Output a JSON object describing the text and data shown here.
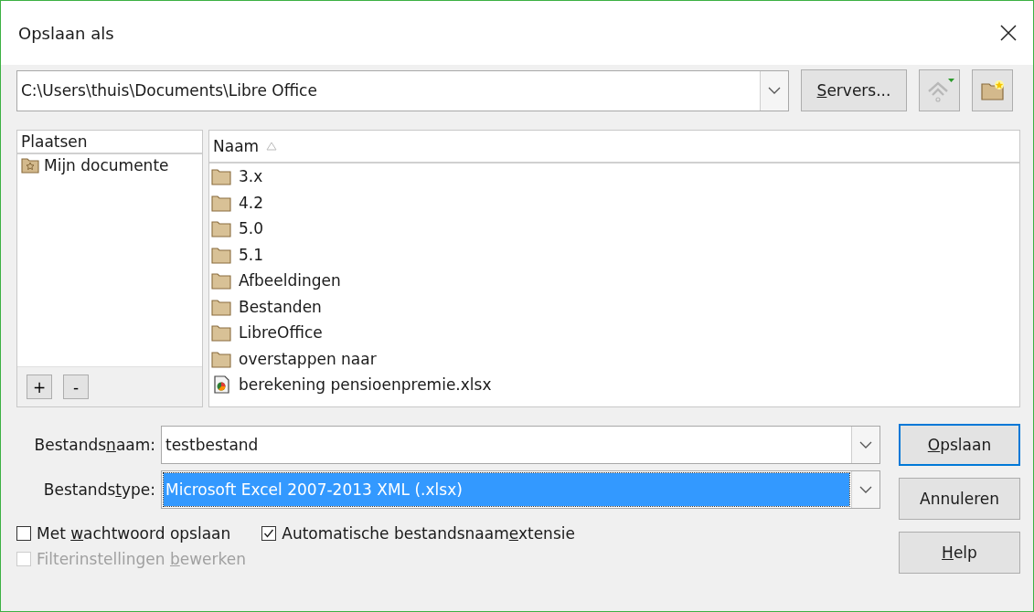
{
  "window": {
    "title": "Opslaan als"
  },
  "path": {
    "value": "C:\\Users\\thuis\\Documents\\Libre Office"
  },
  "servers_button": {
    "label": {
      "key": "S",
      "post": "ervers..."
    }
  },
  "up_button": {
    "disabled": true
  },
  "places": {
    "header": "Plaatsen",
    "items": [
      {
        "label": "Mijn documente",
        "selected": false
      }
    ],
    "add": "+",
    "remove": "-"
  },
  "files": {
    "column": "Naam",
    "items": [
      {
        "name": "3.x",
        "kind": "folder"
      },
      {
        "name": "4.2",
        "kind": "folder"
      },
      {
        "name": "5.0",
        "kind": "folder"
      },
      {
        "name": "5.1",
        "kind": "folder"
      },
      {
        "name": "Afbeeldingen",
        "kind": "folder"
      },
      {
        "name": "Bestanden",
        "kind": "folder"
      },
      {
        "name": "LibreOffice",
        "kind": "folder"
      },
      {
        "name": "overstappen naar",
        "kind": "folder"
      },
      {
        "name": "berekening pensioenpremie.xlsx",
        "kind": "spreadsheet"
      }
    ]
  },
  "filename": {
    "label": {
      "pre": "Bestands",
      "key": "n",
      "post": "aam:"
    },
    "value": "testbestand",
    "highlighted": false
  },
  "filetype": {
    "label": {
      "pre": "Bestands",
      "key": "t",
      "post": "ype:"
    },
    "value": "Microsoft Excel 2007-2013 XML (.xlsx)",
    "highlighted": true
  },
  "options": [
    {
      "label": {
        "pre": "Met ",
        "key": "w",
        "post": "achtwoord opslaan"
      },
      "checked": false,
      "disabled": false
    },
    {
      "label": {
        "pre": "Automatische bestandsnaam",
        "key": "e",
        "post": "xtensie"
      },
      "checked": true,
      "disabled": false
    },
    {
      "label": {
        "pre": "Filterinstellingen ",
        "key": "b",
        "post": "ewerken"
      },
      "checked": false,
      "disabled": true
    }
  ],
  "buttons": [
    {
      "label": {
        "key": "O",
        "post": "pslaan"
      },
      "default": true
    },
    {
      "label": {
        "pre": "Annuleren"
      },
      "default": false
    },
    {
      "label": {
        "key": "H",
        "post": "elp"
      },
      "default": false
    }
  ]
}
